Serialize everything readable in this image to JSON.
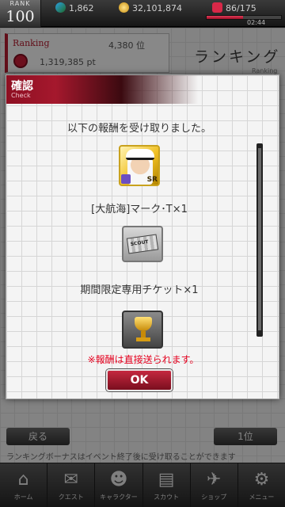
{
  "status": {
    "rank_label": "RANK",
    "rank_value": "100",
    "gems": "1,862",
    "coins": "32,101,874",
    "stamina": "86/175",
    "stamina_fraction": 0.49,
    "timer": "02:44"
  },
  "page": {
    "ranking_label": "Ranking",
    "ranking_position": "4,380 位",
    "ranking_points": "1,319,385 pt",
    "title": "ランキング",
    "title_sub": "Ranking",
    "back_label": "戻る",
    "position_label": "1位",
    "bonus_note": "ランキングボーナスはイベント終了後に受け取ることができます"
  },
  "modal": {
    "title": "確認",
    "subtitle": "Check",
    "message": "以下の報酬を受け取りました。",
    "items": [
      {
        "name": "[大航海]マーク･T×1",
        "rarity": "SR"
      },
      {
        "name": "期間限定専用チケット×1",
        "icon_text": "SCOUT"
      }
    ],
    "note": "※報酬は直接送られます。",
    "ok_label": "OK"
  },
  "nav": [
    {
      "label": "ホーム",
      "icon": "home-icon",
      "glyph": "⌂"
    },
    {
      "label": "クエスト",
      "icon": "quest-icon",
      "glyph": "✉"
    },
    {
      "label": "キャラクター",
      "icon": "character-icon",
      "glyph": "☻"
    },
    {
      "label": "スカウト",
      "icon": "scout-icon",
      "glyph": "▤"
    },
    {
      "label": "ショップ",
      "icon": "shop-icon",
      "glyph": "✈"
    },
    {
      "label": "メニュー",
      "icon": "menu-icon",
      "glyph": "⚙"
    }
  ],
  "colors": {
    "accent_red": "#b21a2e",
    "note_red": "#e5001e"
  }
}
